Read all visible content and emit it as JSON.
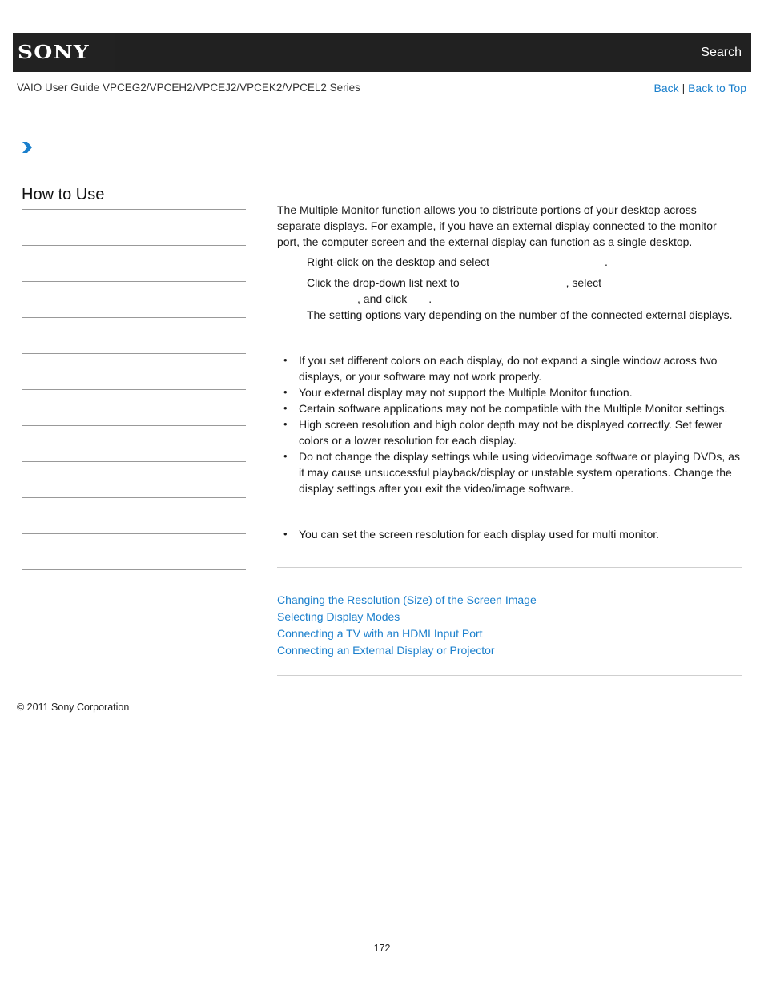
{
  "header": {
    "logo": "SONY",
    "search_label": "Search",
    "guide_title": "VAIO User Guide VPCEG2/VPCEH2/VPCEJ2/VPCEK2/VPCEL2 Series",
    "back_label": "Back",
    "separator": "|",
    "back_to_top_label": "Back to Top"
  },
  "breadcrumb": {
    "icon": "chevron-right-icon",
    "color": "#1a7fcc"
  },
  "sidebar": {
    "title": "How to Use",
    "items": [
      "",
      "",
      "",
      "",
      "",
      "",
      "",
      "",
      "",
      ""
    ]
  },
  "main": {
    "intro": "The Multiple Monitor function allows you to distribute portions of your desktop across separate displays. For example, if you have an external display connected to the monitor port, the computer screen and the external display can function as a single desktop.",
    "steps": {
      "step1_a": "Right-click on the desktop and select",
      "step1_b": ".",
      "step2_a": "Click the drop-down list next to",
      "step2_b": ", select",
      "step2_c": ", and click",
      "step2_d": ".",
      "step2_note": "The setting options vary depending on the number of the connected external displays."
    },
    "notes": [
      "If you set different colors on each display, do not expand a single window across two displays, or your software may not work properly.",
      "Your external display may not support the Multiple Monitor function.",
      "Certain software applications may not be compatible with the Multiple Monitor settings.",
      "High screen resolution and high color depth may not be displayed correctly. Set fewer colors or a lower resolution for each display.",
      "Do not change the display settings while using video/image software or playing DVDs, as it may cause unsuccessful playback/display or unstable system operations. Change the display settings after you exit the video/image software."
    ],
    "hints": [
      "You can set the screen resolution for each display used for multi monitor."
    ],
    "related_links": [
      "Changing the Resolution (Size) of the Screen Image",
      "Selecting Display Modes",
      "Connecting a TV with an HDMI Input Port",
      "Connecting an External Display or Projector"
    ]
  },
  "footer": {
    "copyright": "© 2011 Sony Corporation",
    "page_number": "172"
  },
  "colors": {
    "link": "#1a7fcc",
    "header_bg": "#212121"
  }
}
